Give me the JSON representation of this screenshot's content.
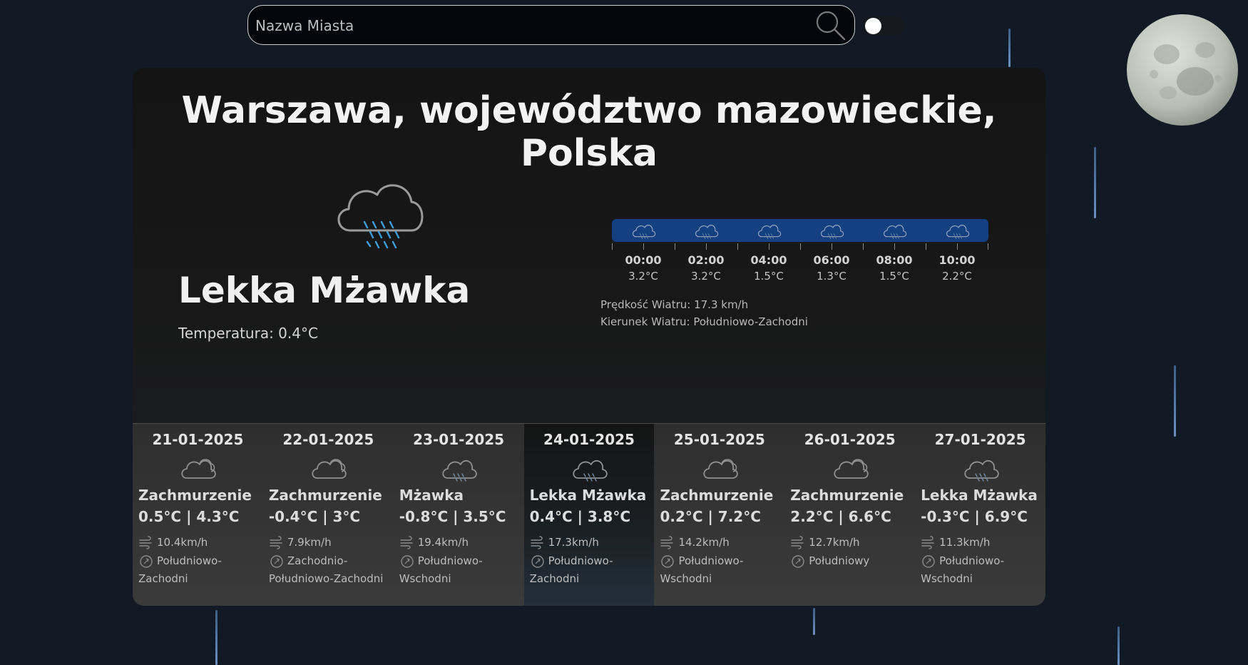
{
  "search": {
    "placeholder": "Nazwa Miasta"
  },
  "current": {
    "location": "Warszawa, województwo mazowieckie, Polska",
    "condition": "Lekka Mżawka",
    "temperature": "Temperatura: 0.4°C",
    "wind_speed": "Prędkość Wiatru: 17.3 km/h",
    "wind_direction": "Kierunek Wiatru: Południowo-Zachodni"
  },
  "hourly": [
    {
      "time": "00:00",
      "temp": "3.2°C"
    },
    {
      "time": "02:00",
      "temp": "3.2°C"
    },
    {
      "time": "04:00",
      "temp": "1.5°C"
    },
    {
      "time": "06:00",
      "temp": "1.3°C"
    },
    {
      "time": "08:00",
      "temp": "1.5°C"
    },
    {
      "time": "10:00",
      "temp": "2.2°C"
    }
  ],
  "forecast": [
    {
      "date": "21-01-2025",
      "condition": "Zachmurzenie",
      "temps": "0.5°C | 4.3°C",
      "wind": "10.4km/h",
      "direction": "Południowo-Zachodni",
      "icon": "partly-cloudy-icon"
    },
    {
      "date": "22-01-2025",
      "condition": "Zachmurzenie",
      "temps": "-0.4°C | 3°C",
      "wind": "7.9km/h",
      "direction": "Zachodnio-Południowo-Zachodni",
      "icon": "partly-cloudy-icon"
    },
    {
      "date": "23-01-2025",
      "condition": "Mżawka",
      "temps": "-0.8°C | 3.5°C",
      "wind": "19.4km/h",
      "direction": "Południowo-Wschodni",
      "icon": "drizzle-icon"
    },
    {
      "date": "24-01-2025",
      "condition": "Lekka Mżawka",
      "temps": "0.4°C | 3.8°C",
      "wind": "17.3km/h",
      "direction": "Południowo-Zachodni",
      "icon": "drizzle-icon"
    },
    {
      "date": "25-01-2025",
      "condition": "Zachmurzenie",
      "temps": "0.2°C | 7.2°C",
      "wind": "14.2km/h",
      "direction": "Południowo-Wschodni",
      "icon": "partly-cloudy-icon"
    },
    {
      "date": "26-01-2025",
      "condition": "Zachmurzenie",
      "temps": "2.2°C | 6.6°C",
      "wind": "12.7km/h",
      "direction": "Południowy",
      "icon": "partly-cloudy-icon"
    },
    {
      "date": "27-01-2025",
      "condition": "Lekka Mżawka",
      "temps": "-0.3°C | 6.9°C",
      "wind": "11.3km/h",
      "direction": "Południowo-Wschodni",
      "icon": "drizzle-icon"
    }
  ],
  "colors": {
    "background": "#111a24",
    "accent": "#143f80",
    "rain": "#6a90bb"
  }
}
